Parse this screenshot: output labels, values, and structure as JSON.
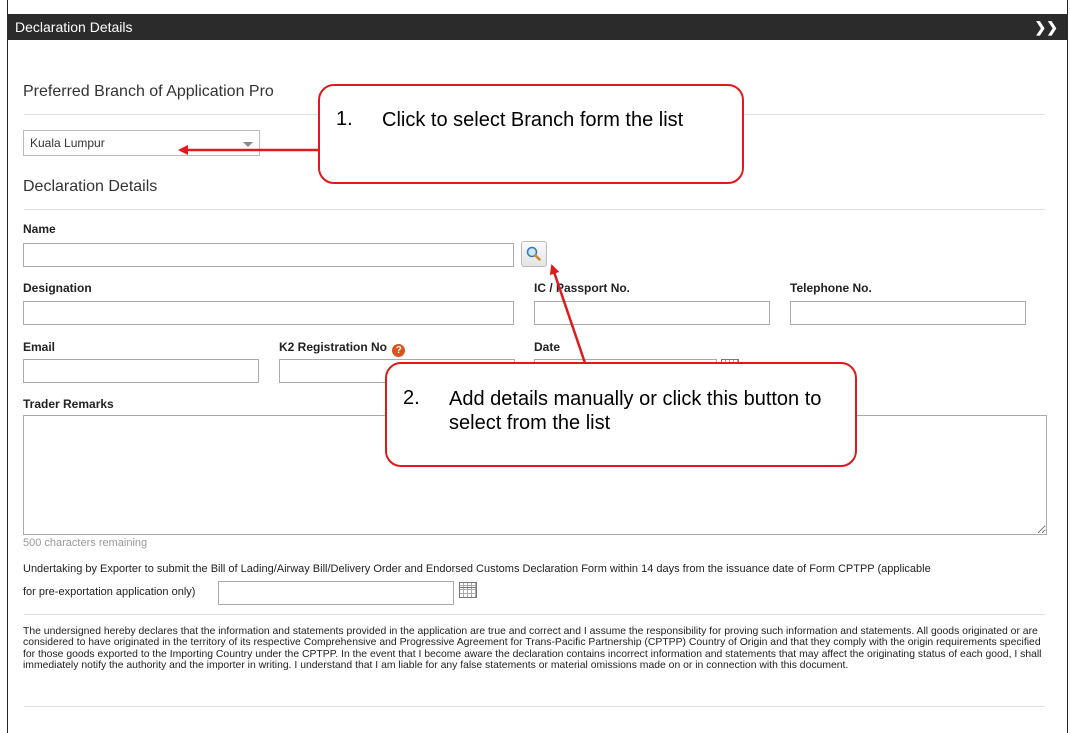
{
  "panel": {
    "title": "Declaration Details",
    "collapse_icon": "double-chevron-down-icon"
  },
  "branch_section": {
    "title": "Preferred Branch of Application Pro",
    "selected_branch": "Kuala Lumpur"
  },
  "declaration_section": {
    "title": "Declaration Details"
  },
  "fields": {
    "name_label": "Name",
    "designation_label": "Designation",
    "ic_label": "IC / Passport No.",
    "telephone_label": "Telephone No.",
    "email_label": "Email",
    "k2_label": "K2 Registration No",
    "date_label": "Date",
    "remarks_label": "Trader Remarks",
    "remarks_remaining": "500 characters remaining"
  },
  "undertaking": {
    "line1": "Undertaking by Exporter to submit the Bill of Lading/Airway Bill/Delivery Order and Endorsed Customs Declaration Form within 14 days from the issuance date of Form CPTPP (applicable",
    "line2": "for pre-exportation application only)"
  },
  "declaration_text": "The undersigned hereby declares that the information and statements provided in the application are true and correct and I assume the responsibility for proving such information and statements. All goods originated or are considered to have originated in the territory of its respective Comprehensive and Progressive Agreement for Trans-Pacific Partnership (CPTPP) Country of Origin and that they comply with the origin requirements specified for those goods exported to the Importing Country under the CPTPP. In the event that I become aware the declaration contains incorrect information and statements that may affect the originating status of each good, I shall immediately notify the authority and the importer in writing. I understand that I am liable for any false statements or material omissions made on or in connection with this document.",
  "callouts": {
    "c1_num": "1.",
    "c1_text": "Click to select Branch form the list",
    "c2_num": "2.",
    "c2_text": "Add details manually or click this button to select from the list"
  },
  "colors": {
    "annotation_red": "#e01a1a",
    "header_bg": "#2b2b2b",
    "help_orange": "#d9531e"
  }
}
